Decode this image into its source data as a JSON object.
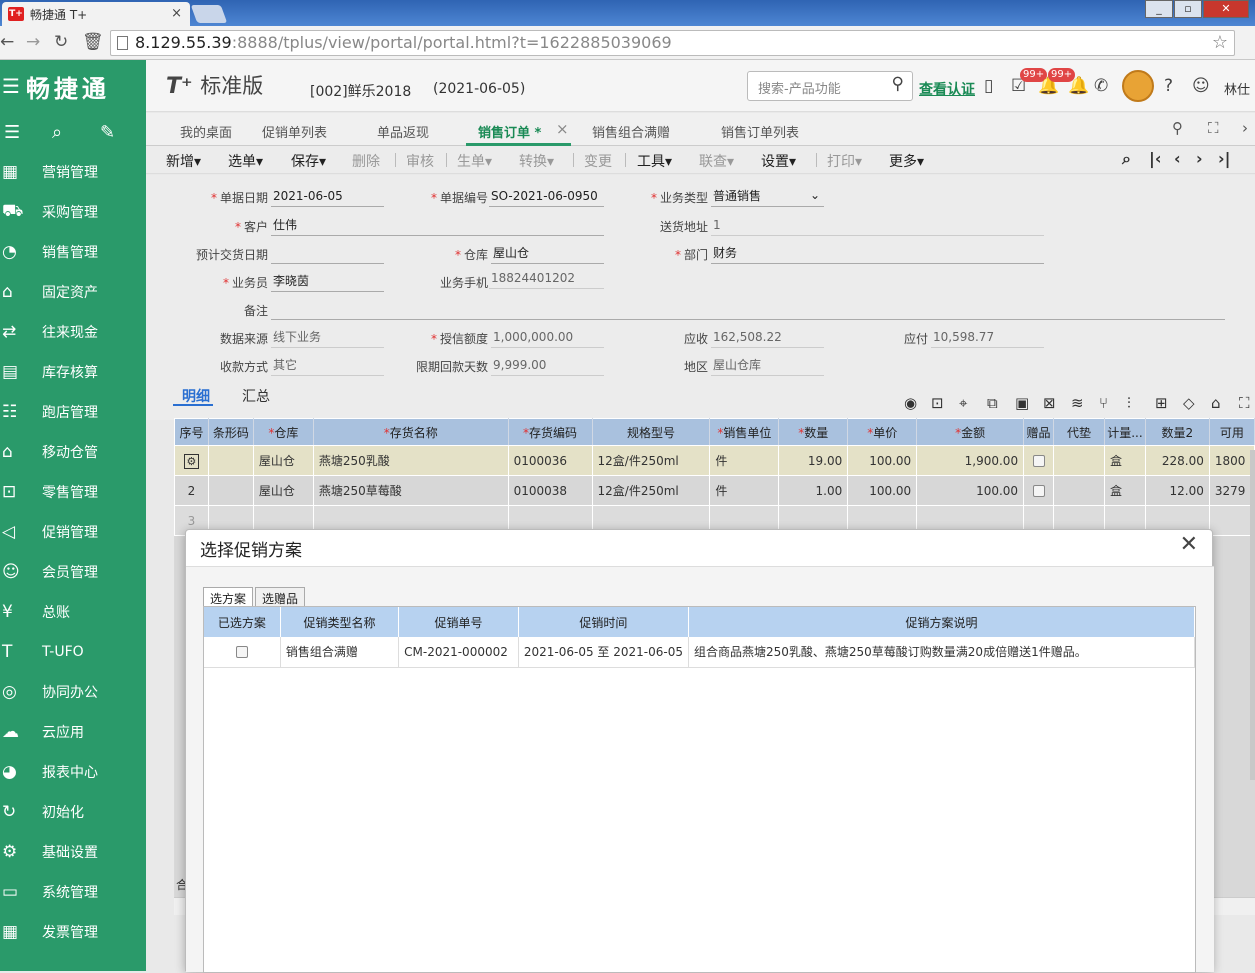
{
  "browser": {
    "tab_title": "畅捷通 T+",
    "tab_favicon": "T+",
    "url_host": "8.129.55.39",
    "url_rest": ":8888/tplus/view/portal/portal.html?t=1622885039069"
  },
  "sidebar": {
    "logo": "畅捷通",
    "items": [
      {
        "icon": "marketing-icon",
        "glyph": "▦",
        "label": "营销管理"
      },
      {
        "icon": "purchase-icon",
        "glyph": "⛟",
        "label": "采购管理"
      },
      {
        "icon": "sales-icon",
        "glyph": "◔",
        "label": "销售管理"
      },
      {
        "icon": "fixed-assets-icon",
        "glyph": "⌂",
        "label": "固定资产"
      },
      {
        "icon": "cash-icon",
        "glyph": "⇄",
        "label": "往来现金"
      },
      {
        "icon": "inventory-icon",
        "glyph": "▤",
        "label": "库存核算"
      },
      {
        "icon": "store-icon",
        "glyph": "☷",
        "label": "跑店管理"
      },
      {
        "icon": "mobile-warehouse-icon",
        "glyph": "⌂",
        "label": "移动仓管"
      },
      {
        "icon": "retail-icon",
        "glyph": "⊡",
        "label": "零售管理"
      },
      {
        "icon": "promotion-icon",
        "glyph": "◁",
        "label": "促销管理"
      },
      {
        "icon": "member-icon",
        "glyph": "☺",
        "label": "会员管理"
      },
      {
        "icon": "ledger-icon",
        "glyph": "¥",
        "label": "总账"
      },
      {
        "icon": "ufo-icon",
        "glyph": "T",
        "label": "T-UFO"
      },
      {
        "icon": "collab-icon",
        "glyph": "◎",
        "label": "协同办公"
      },
      {
        "icon": "cloud-icon",
        "glyph": "☁",
        "label": "云应用"
      },
      {
        "icon": "report-icon",
        "glyph": "◕",
        "label": "报表中心"
      },
      {
        "icon": "init-icon",
        "glyph": "↻",
        "label": "初始化"
      },
      {
        "icon": "base-settings-icon",
        "glyph": "⚙",
        "label": "基础设置"
      },
      {
        "icon": "system-icon",
        "glyph": "▭",
        "label": "系统管理"
      },
      {
        "icon": "invoice-icon",
        "glyph": "▦",
        "label": "发票管理"
      }
    ]
  },
  "header": {
    "brand": "T⁺",
    "edition": "标准版",
    "account": "[002]鲜乐2018",
    "date": "(2021-06-05)",
    "search_placeholder": "搜索-产品功能",
    "auth_link": "查看认证",
    "badge1": "99+",
    "badge2": "99+",
    "user": "林仕"
  },
  "doc_tabs": [
    {
      "label": "我的桌面"
    },
    {
      "label": "促销单列表"
    },
    {
      "label": "单品返现"
    },
    {
      "label": "销售订单 *"
    },
    {
      "label": "销售组合满赠"
    },
    {
      "label": "销售订单列表"
    }
  ],
  "toolbar": {
    "new": "新增",
    "select": "选单",
    "save": "保存",
    "delete": "删除",
    "audit": "审核",
    "gen": "生单",
    "convert": "转换",
    "change": "变更",
    "tools": "工具",
    "query": "联查",
    "settings": "设置",
    "print": "打印",
    "more": "更多"
  },
  "form": {
    "doc_date_label": "单据日期",
    "doc_date": "2021-06-05",
    "doc_no_label": "单据编号",
    "doc_no": "SO-2021-06-0950",
    "biz_type_label": "业务类型",
    "biz_type": "普通销售",
    "customer_label": "客户",
    "customer": "仕伟",
    "ship_addr_label": "送货地址",
    "ship_addr": "1",
    "delivery_date_label": "预计交货日期",
    "delivery_date": "",
    "warehouse_label": "仓库",
    "warehouse": "屋山仓",
    "dept_label": "部门",
    "dept": "财务",
    "salesman_label": "业务员",
    "salesman": "李晓茵",
    "phone_label": "业务手机",
    "phone": "18824401202",
    "note_label": "备注",
    "note": "",
    "source_label": "数据来源",
    "source": "线下业务",
    "credit_label": "授信额度",
    "credit": "1,000,000.00",
    "receivable_label": "应收",
    "receivable": "162,508.22",
    "payable_label": "应付",
    "payable": "10,598.77",
    "collect_label": "收款方式",
    "collect": "其它",
    "days_label": "限期回款天数",
    "days": "9,999.00",
    "region_label": "地区",
    "region": "屋山仓库"
  },
  "subtabs": {
    "detail": "明细",
    "summary": "汇总"
  },
  "grid": {
    "headers": [
      "序号",
      "条形码",
      "仓库",
      "存货名称",
      "存货编码",
      "规格型号",
      "销售单位",
      "数量",
      "单价",
      "金额",
      "赠品",
      "代垫",
      "计量...",
      "数量2",
      "可用"
    ],
    "rows": [
      {
        "seq": "",
        "barcode": "",
        "warehouse": "屋山仓",
        "name": "燕塘250乳酸",
        "code": "0100036",
        "spec": "12盒/件250ml",
        "unit": "件",
        "qty": "19.00",
        "price": "100.00",
        "amount": "1,900.00",
        "measure": "盒",
        "qty2": "228.00",
        "avail": "1800"
      },
      {
        "seq": "2",
        "barcode": "",
        "warehouse": "屋山仓",
        "name": "燕塘250草莓酸",
        "code": "0100038",
        "spec": "12盒/件250ml",
        "unit": "件",
        "qty": "1.00",
        "price": "100.00",
        "amount": "100.00",
        "measure": "盒",
        "qty2": "12.00",
        "avail": "3279"
      }
    ],
    "row3_seq": "3",
    "footer_label": "合"
  },
  "modal": {
    "title": "选择促销方案",
    "tab1": "选方案",
    "tab2": "选赠品",
    "headers": [
      "已选方案",
      "促销类型名称",
      "促销单号",
      "促销时间",
      "促销方案说明"
    ],
    "rows": [
      {
        "type": "销售组合满赠",
        "no": "CM-2021-000002",
        "time": "2021-06-05 至 2021-06-05",
        "desc": "组合商品燕塘250乳酸、燕塘250草莓酸订购数量满20成倍赠送1件赠品。"
      }
    ]
  }
}
